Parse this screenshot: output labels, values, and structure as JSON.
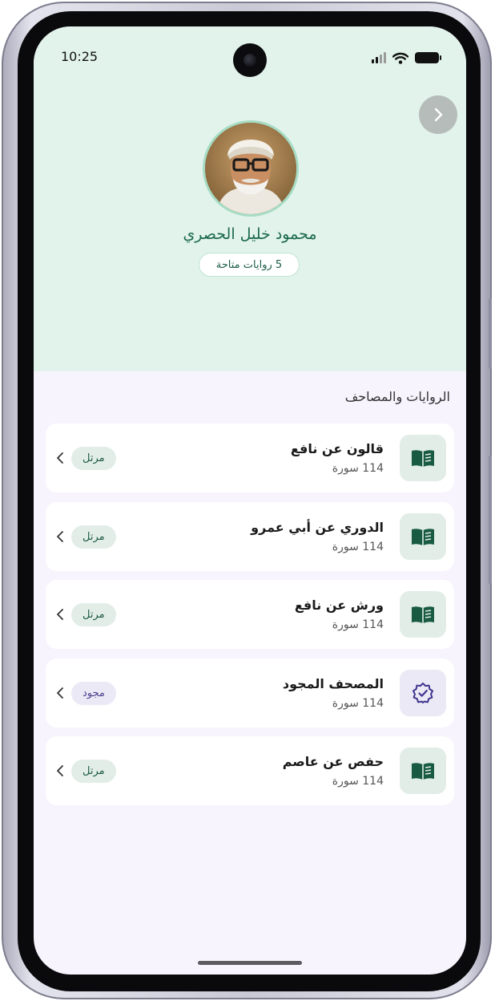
{
  "status_bar": {
    "time": "10:25"
  },
  "reciter": {
    "name": "محمود خليل الحصري",
    "available_label": "5 روايات متاحة"
  },
  "section_title": "الروايات والمصاحف",
  "narrations": [
    {
      "title": "قالون عن نافع",
      "subtitle": "114 سورة",
      "tag": "مرتل",
      "icon": "open-book-icon",
      "variant": "green"
    },
    {
      "title": "الدوري عن أبي عمرو",
      "subtitle": "114 سورة",
      "tag": "مرتل",
      "icon": "open-book-icon",
      "variant": "green"
    },
    {
      "title": "ورش عن نافع",
      "subtitle": "114 سورة",
      "tag": "مرتل",
      "icon": "open-book-icon",
      "variant": "green"
    },
    {
      "title": "المصحف المجود",
      "subtitle": "114 سورة",
      "tag": "مجود",
      "icon": "verified-badge-icon",
      "variant": "purple"
    },
    {
      "title": "حفص عن عاصم",
      "subtitle": "114 سورة",
      "tag": "مرتل",
      "icon": "open-book-icon",
      "variant": "green"
    }
  ],
  "colors": {
    "header_bg": "#e2f3ec",
    "screen_bg": "#f7f4fd",
    "accent_green": "#1b6a4c",
    "accent_purple": "#4c4191"
  }
}
